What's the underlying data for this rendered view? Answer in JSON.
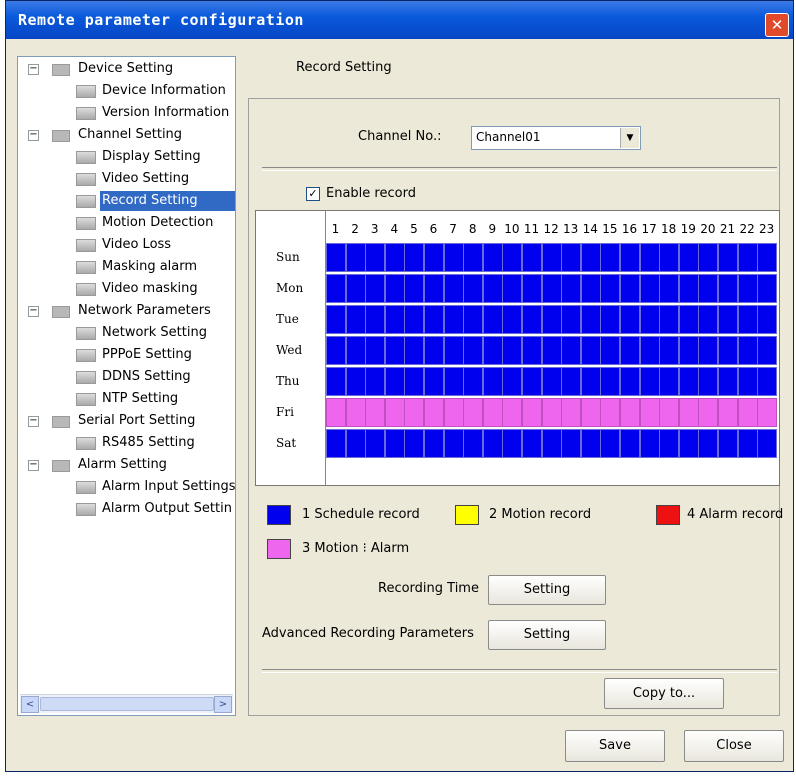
{
  "window": {
    "title": "Remote parameter configuration",
    "close_glyph": "✕"
  },
  "tree": [
    {
      "label": "Device Setting",
      "level": 0,
      "expander": "⊟"
    },
    {
      "label": "Device Information",
      "level": 1
    },
    {
      "label": "Version Information",
      "level": 1
    },
    {
      "label": "Channel Setting",
      "level": 0,
      "expander": "⊟"
    },
    {
      "label": "Display Setting",
      "level": 1
    },
    {
      "label": "Video Setting",
      "level": 1
    },
    {
      "label": "Record Setting",
      "level": 1,
      "selected": true
    },
    {
      "label": "Motion Detection",
      "level": 1
    },
    {
      "label": "Video Loss",
      "level": 1
    },
    {
      "label": "Masking alarm",
      "level": 1
    },
    {
      "label": "Video masking",
      "level": 1
    },
    {
      "label": "Network Parameters",
      "level": 0,
      "expander": "⊟"
    },
    {
      "label": "Network Setting",
      "level": 1
    },
    {
      "label": "PPPoE Setting",
      "level": 1
    },
    {
      "label": "DDNS Setting",
      "level": 1
    },
    {
      "label": "NTP Setting",
      "level": 1
    },
    {
      "label": "Serial Port Setting",
      "level": 0,
      "expander": "⊟"
    },
    {
      "label": "RS485 Setting",
      "level": 1
    },
    {
      "label": "Alarm Setting",
      "level": 0,
      "expander": "⊟"
    },
    {
      "label": "Alarm Input Settings",
      "level": 1
    },
    {
      "label": "Alarm Output Settin",
      "level": 1
    }
  ],
  "scrollbar": {
    "left_glyph": "<",
    "right_glyph": ">"
  },
  "record": {
    "section_title": "Record Setting",
    "channel_label": "Channel No.:",
    "channel_value": "Channel01",
    "dropdown_glyph": "▼",
    "enable_label": "Enable record",
    "enable_checked": true,
    "check_glyph": "✓",
    "hours": [
      "1",
      "2",
      "3",
      "4",
      "5",
      "6",
      "7",
      "8",
      "9",
      "10",
      "11",
      "12",
      "13",
      "14",
      "15",
      "16",
      "17",
      "18",
      "19",
      "20",
      "21",
      "22",
      "23"
    ],
    "days": [
      "Sun",
      "Mon",
      "Tue",
      "Wed",
      "Thu",
      "Fri",
      "Sat"
    ],
    "schedule_types": {
      "Sun": 1,
      "Mon": 1,
      "Tue": 1,
      "Wed": 1,
      "Thu": 1,
      "Fri": 3,
      "Sat": 1
    },
    "legend": [
      {
        "label": "1 Schedule record",
        "color": "#0000ee"
      },
      {
        "label": "2 Motion record",
        "color": "#ffff00"
      },
      {
        "label": "4 Alarm record",
        "color": "#ee1111"
      },
      {
        "label": "3 Motion ⁝ Alarm",
        "color": "#ee66ee"
      }
    ],
    "recording_time_label": "Recording Time",
    "advanced_label": "Advanced Recording Parameters",
    "setting_button": "Setting",
    "copy_button": "Copy to..."
  },
  "footer": {
    "save": "Save",
    "close": "Close"
  }
}
